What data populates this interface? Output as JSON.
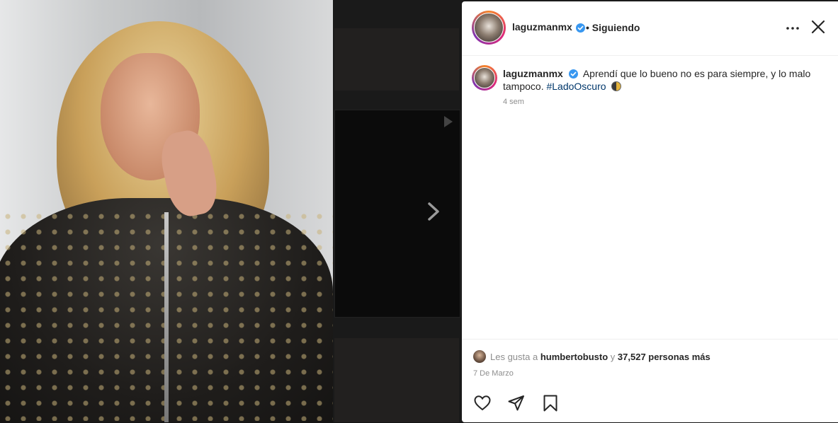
{
  "post": {
    "username": "laguzmanmx",
    "follow_status": "• Siguiendo",
    "caption_text": "Aprendí que lo bueno no es para siempre, y lo malo tampoco.",
    "hashtag": "#LadoOscuro",
    "time_ago": "4 sem",
    "likes": {
      "prefix": "Les gusta a",
      "liker": "humbertobusto",
      "connector": "y",
      "others": "37,527 personas más"
    },
    "date": "7 De Marzo"
  },
  "icons": {
    "more": "more-options-icon",
    "close": "close-icon",
    "verified": "verified-badge-icon",
    "like": "heart-icon",
    "share": "send-icon",
    "save": "bookmark-icon",
    "next": "chevron-right-icon",
    "emoji": "moon-emoji"
  },
  "colors": {
    "verified": "#3897f0",
    "hashtag": "#00376b",
    "muted": "#8e8e8e"
  }
}
